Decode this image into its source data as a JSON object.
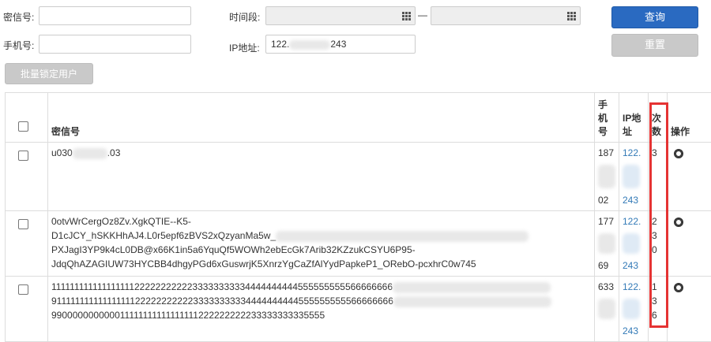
{
  "form": {
    "secret_label": "密信号:",
    "secret_value": "",
    "phone_label": "手机号:",
    "phone_value": "",
    "time_label": "时间段:",
    "time_start": "",
    "time_sep": "—",
    "time_end": "",
    "ip_label": "IP地址:",
    "ip_prefix": "122.",
    "ip_suffix": "243",
    "query_label": "查询",
    "reset_label": "重置",
    "batch_lock_label": "批量锁定用户"
  },
  "table": {
    "headers": {
      "secret": "密信号",
      "phone": "手机号",
      "ip": "IP地址",
      "count": "次数",
      "action": "操作"
    },
    "rows": [
      {
        "secret_prefix": "u030",
        "secret_suffix": ".03",
        "secret_lines": [],
        "phone_top": "187",
        "phone_bottom": "02",
        "ip_top": "122.",
        "ip_bottom": "243",
        "count": "3"
      },
      {
        "secret_prefix": "",
        "secret_suffix": "",
        "secret_lines": [
          "0otvWrCergOz8Zv.XgkQTIE--K5-",
          "D1cJCY_hSKKHhAJ4.L0r5epf6zBVS2xQzyanMa5w_",
          "PXJagI3YP9k4cL0DB@x66K1in5a6YquQf5WOWh2ebEcGk7Arib32KZzukCSYU6P95-",
          "JdqQhAZAGIUW73HYCBB4dhgyPGd6xGuswrjK5XnrzYgCaZfAlYydPapkeP1_ORebO-pcxhrC0w745"
        ],
        "phone_top": "177",
        "phone_bottom": "69",
        "ip_top": "122.",
        "ip_bottom": "243",
        "count": "2\n3\n0"
      },
      {
        "secret_prefix": "",
        "secret_suffix": "",
        "secret_lines": [
          "1111111111111111112222222222233333333334444444444555555555566666666",
          "9111111111111111112222222222233333333334444444444555555555566666666",
          "990000000000011111111111111111222222222233333333335555"
        ],
        "phone_top": "633",
        "phone_bottom": "",
        "ip_top": "122.",
        "ip_bottom": "243",
        "count": "1\n3\n6"
      }
    ]
  },
  "colors": {
    "primary": "#2a6ac1",
    "link": "#337ab7",
    "highlight": "#e53333"
  }
}
